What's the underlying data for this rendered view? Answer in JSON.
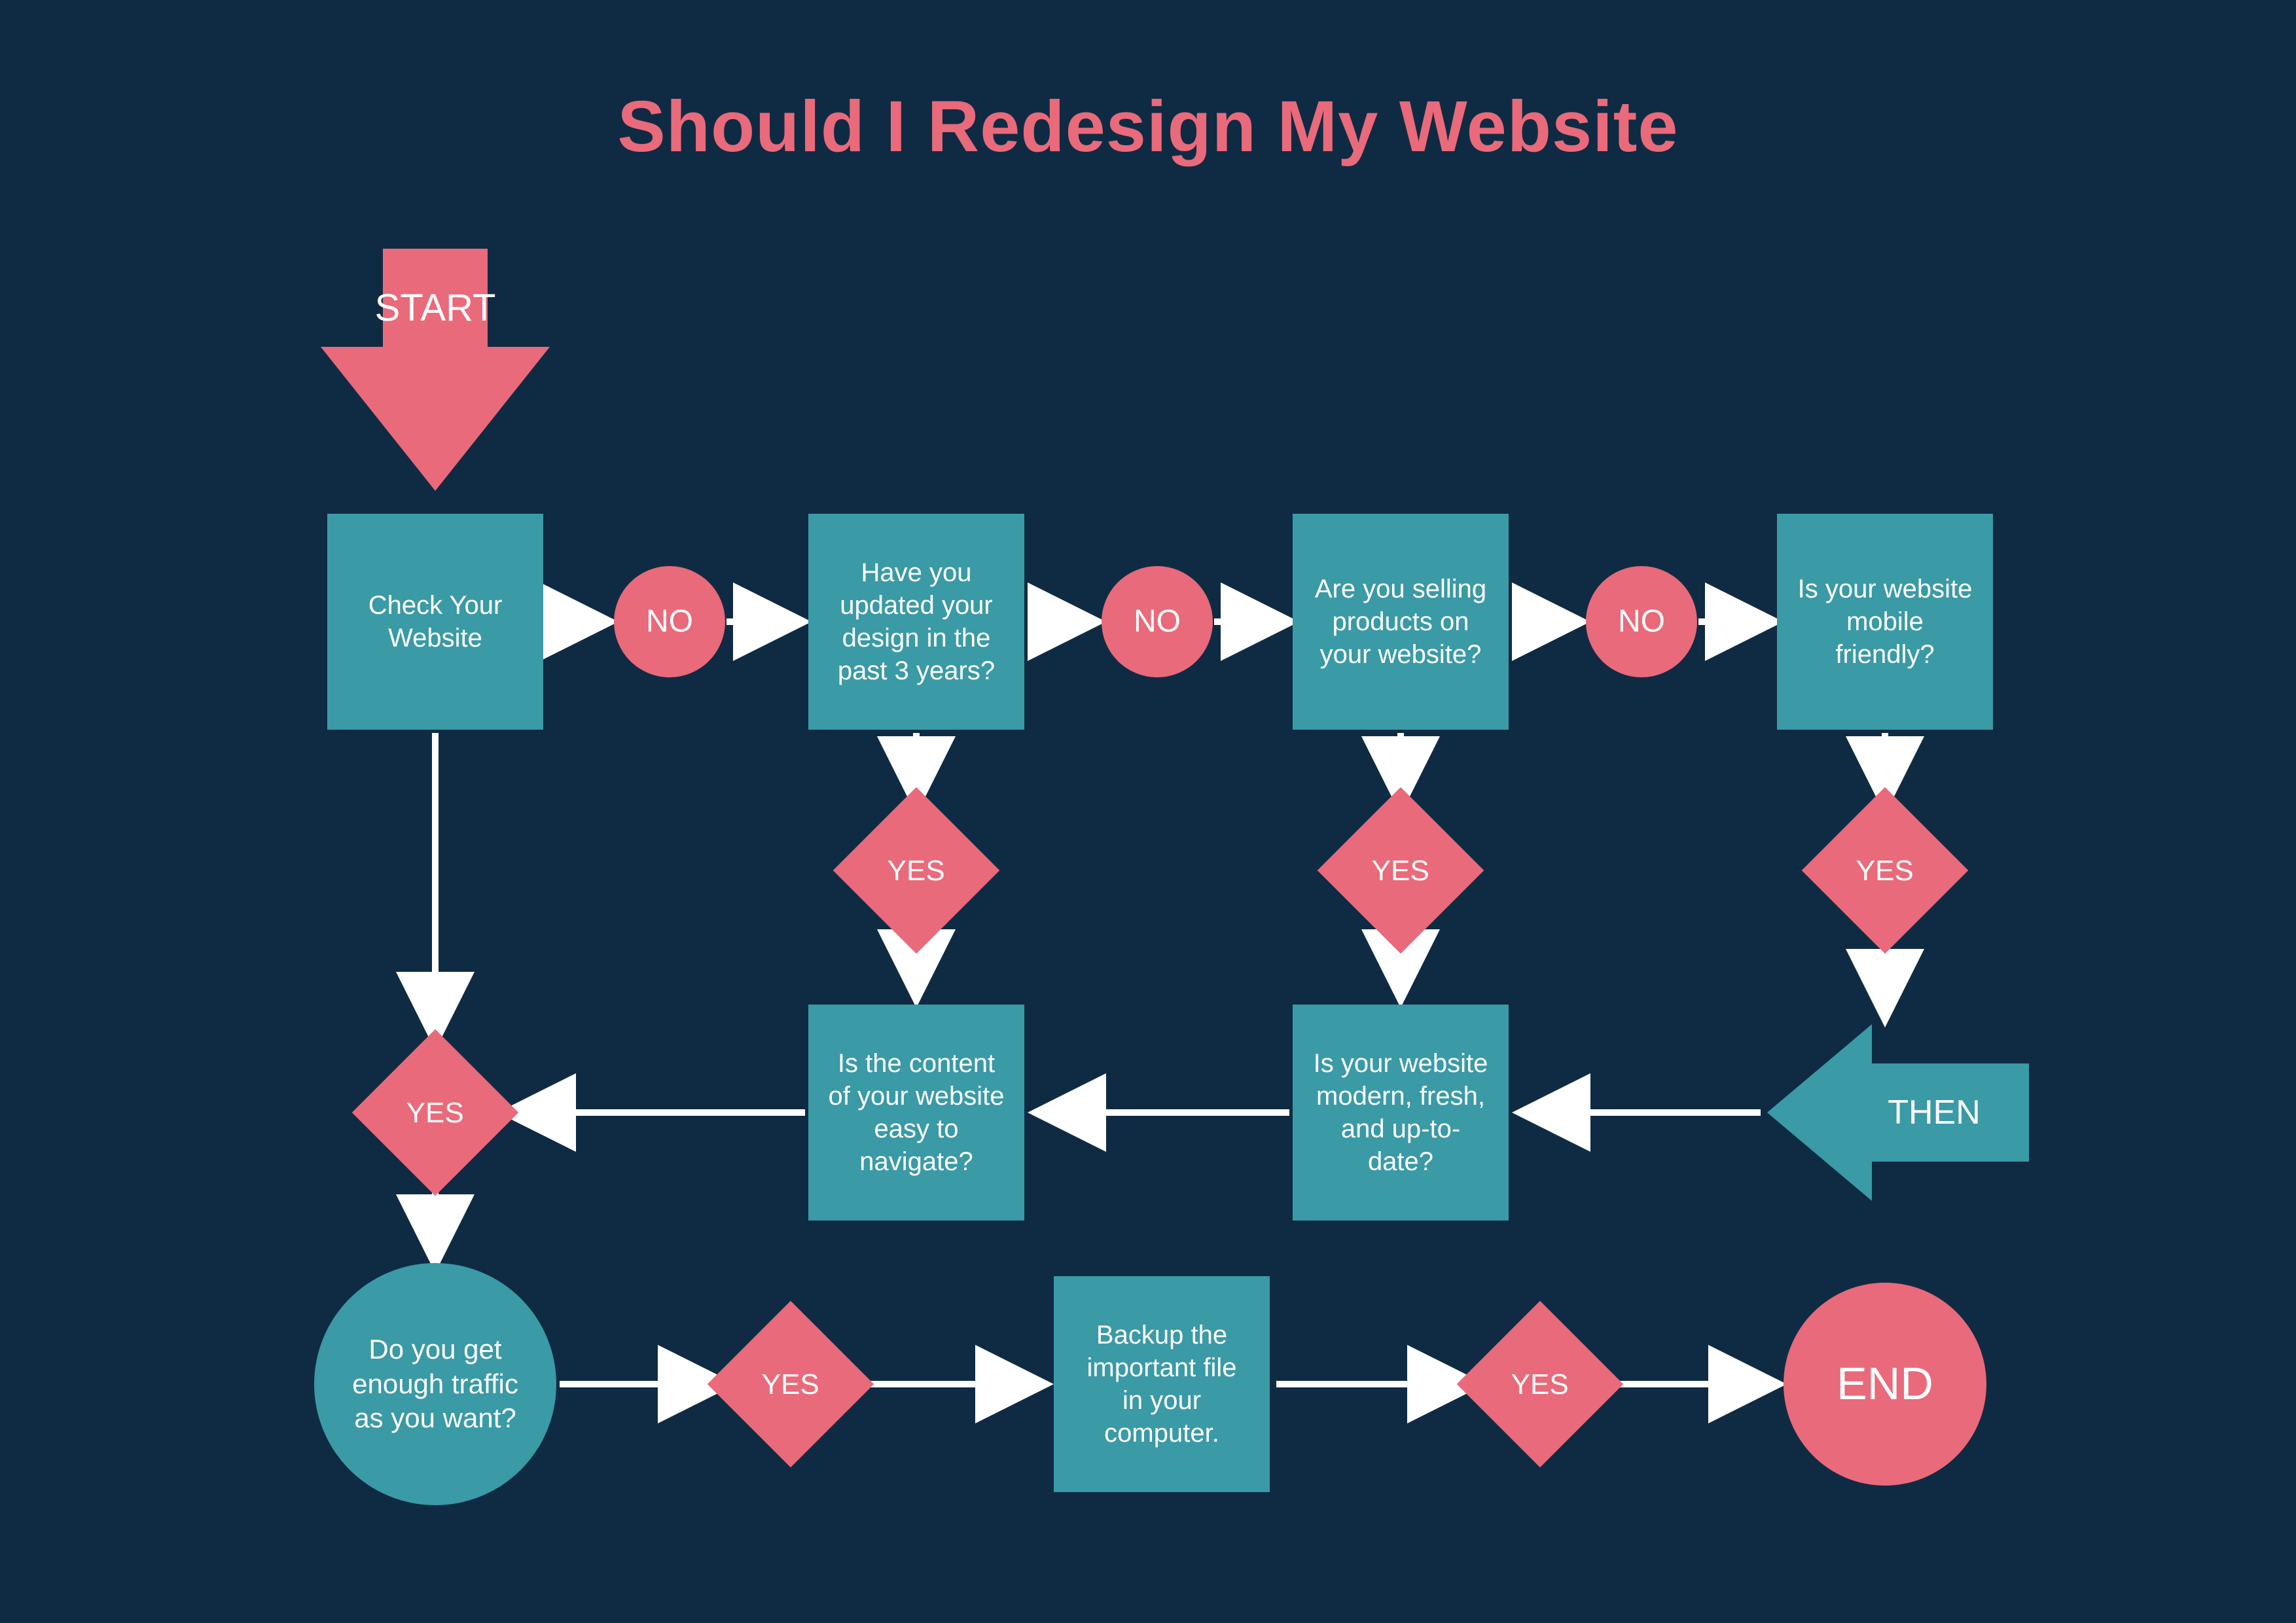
{
  "title": "Should I Redesign My Website",
  "nodes": {
    "start": "START",
    "check": "Check Your Website",
    "updated": "Have you updated your design in the past 3 years?",
    "selling": "Are you selling products on your website?",
    "mobile": "Is your website mobile friendly?",
    "navigate": "Is the content of your website easy to navigate?",
    "modern": "Is your website modern, fresh, and up-to-date?",
    "then": "THEN",
    "traffic": "Do you get enough traffic as you want?",
    "backup": "Backup the important file in your computer.",
    "end": "END",
    "no": "NO",
    "yes": "YES"
  },
  "colors": {
    "bg": "#0f2b44",
    "teal": "#3a9aa6",
    "pink": "#e96a7a",
    "text": "#ffffff"
  },
  "chart_data": {
    "type": "flowchart",
    "title": "Should I Redesign My Website",
    "nodes": [
      {
        "id": "start",
        "shape": "arrow-down",
        "color": "pink",
        "label": "START"
      },
      {
        "id": "check",
        "shape": "rect",
        "color": "teal",
        "label": "Check Your Website"
      },
      {
        "id": "no1",
        "shape": "circle",
        "color": "pink",
        "label": "NO"
      },
      {
        "id": "updated",
        "shape": "rect",
        "color": "teal",
        "label": "Have you updated your design in the past 3 years?"
      },
      {
        "id": "no2",
        "shape": "circle",
        "color": "pink",
        "label": "NO"
      },
      {
        "id": "selling",
        "shape": "rect",
        "color": "teal",
        "label": "Are you selling products on your website?"
      },
      {
        "id": "no3",
        "shape": "circle",
        "color": "pink",
        "label": "NO"
      },
      {
        "id": "mobile",
        "shape": "rect",
        "color": "teal",
        "label": "Is your website mobile friendly?"
      },
      {
        "id": "yes1",
        "shape": "diamond",
        "color": "pink",
        "label": "YES"
      },
      {
        "id": "yes2",
        "shape": "diamond",
        "color": "pink",
        "label": "YES"
      },
      {
        "id": "yes3",
        "shape": "diamond",
        "color": "pink",
        "label": "YES"
      },
      {
        "id": "navigate",
        "shape": "rect",
        "color": "teal",
        "label": "Is the content of your website easy to navigate?"
      },
      {
        "id": "modern",
        "shape": "rect",
        "color": "teal",
        "label": "Is your website modern, fresh, and up-to-date?"
      },
      {
        "id": "then",
        "shape": "arrow-left",
        "color": "teal",
        "label": "THEN"
      },
      {
        "id": "yesL",
        "shape": "diamond",
        "color": "pink",
        "label": "YES"
      },
      {
        "id": "traffic",
        "shape": "circle",
        "color": "teal",
        "label": "Do you get enough traffic as you want?"
      },
      {
        "id": "yes4",
        "shape": "diamond",
        "color": "pink",
        "label": "YES"
      },
      {
        "id": "backup",
        "shape": "rect",
        "color": "teal",
        "label": "Backup the important file in your computer."
      },
      {
        "id": "yes5",
        "shape": "diamond",
        "color": "pink",
        "label": "YES"
      },
      {
        "id": "end",
        "shape": "circle",
        "color": "pink",
        "label": "END"
      }
    ],
    "edges": [
      {
        "from": "start",
        "to": "check"
      },
      {
        "from": "check",
        "to": "no1"
      },
      {
        "from": "no1",
        "to": "updated"
      },
      {
        "from": "updated",
        "to": "no2"
      },
      {
        "from": "no2",
        "to": "selling"
      },
      {
        "from": "selling",
        "to": "no3"
      },
      {
        "from": "no3",
        "to": "mobile"
      },
      {
        "from": "updated",
        "to": "yes1"
      },
      {
        "from": "selling",
        "to": "yes2"
      },
      {
        "from": "mobile",
        "to": "yes3"
      },
      {
        "from": "yes1",
        "to": "navigate"
      },
      {
        "from": "yes2",
        "to": "modern"
      },
      {
        "from": "yes3",
        "to": "then"
      },
      {
        "from": "then",
        "to": "modern"
      },
      {
        "from": "modern",
        "to": "navigate"
      },
      {
        "from": "navigate",
        "to": "yesL"
      },
      {
        "from": "check",
        "to": "yesL"
      },
      {
        "from": "yesL",
        "to": "traffic"
      },
      {
        "from": "traffic",
        "to": "yes4"
      },
      {
        "from": "yes4",
        "to": "backup"
      },
      {
        "from": "backup",
        "to": "yes5"
      },
      {
        "from": "yes5",
        "to": "end"
      }
    ]
  }
}
